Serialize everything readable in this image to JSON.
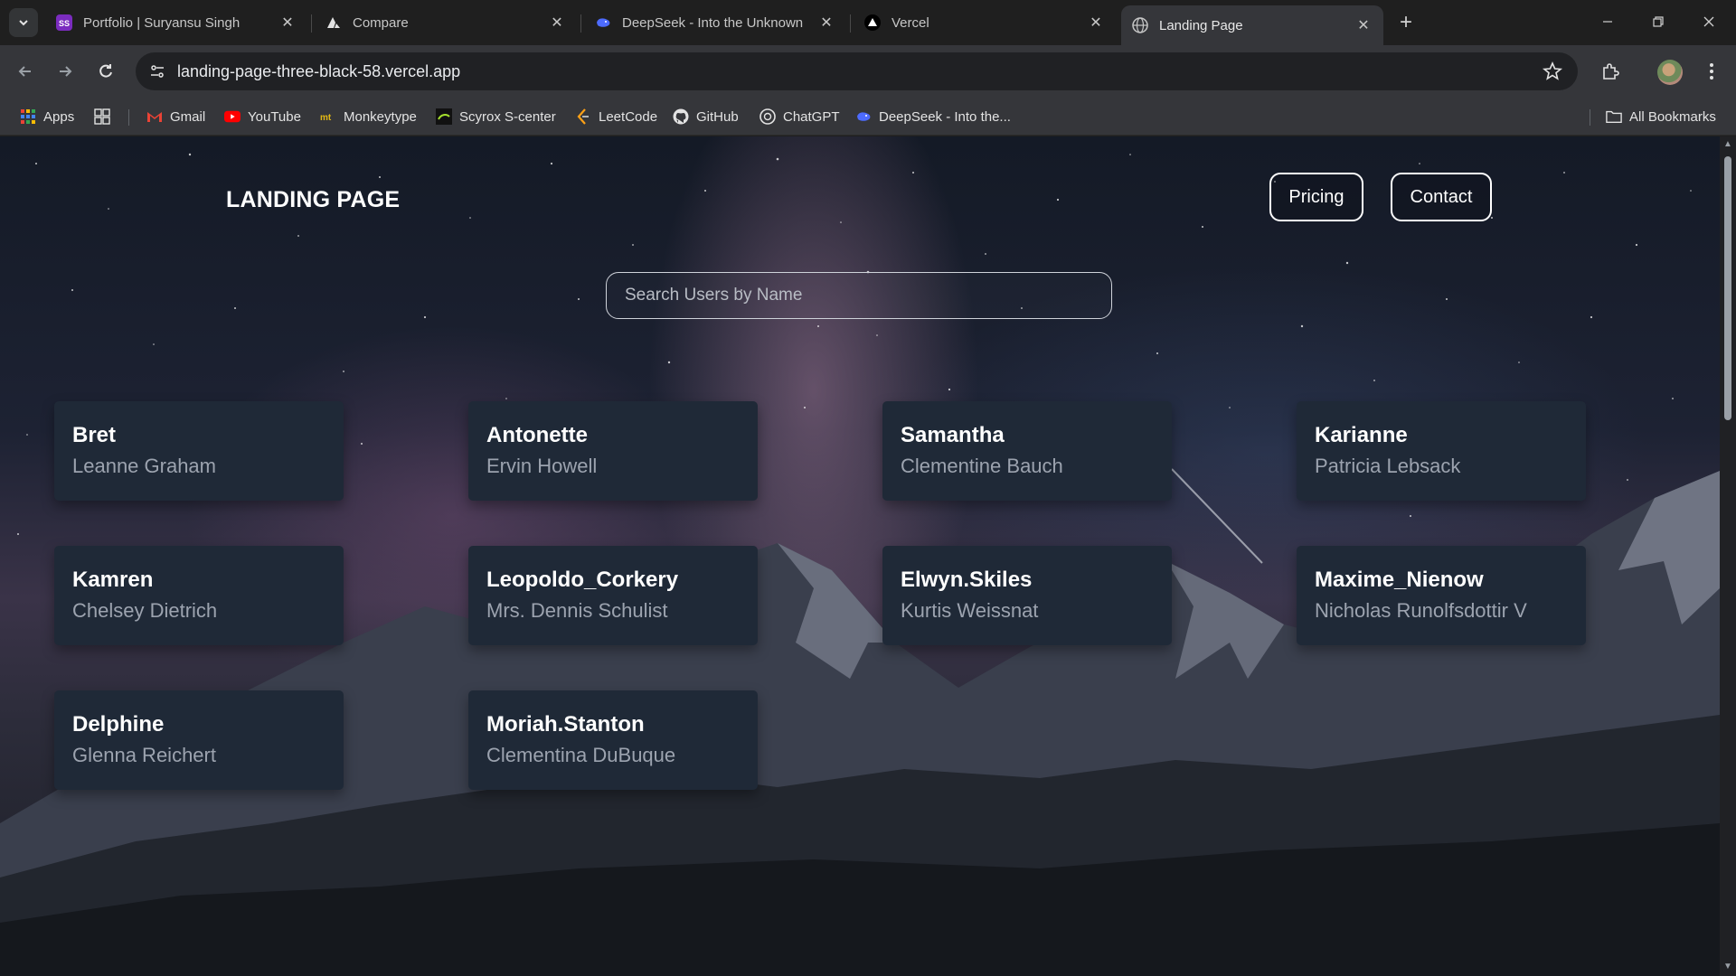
{
  "browser": {
    "tabs": [
      {
        "title": "Portfolio | Suryansu Singh",
        "favicon": "ss-logo-icon"
      },
      {
        "title": "Compare",
        "favicon": "compare-logo-icon"
      },
      {
        "title": "DeepSeek - Into the Unknown",
        "favicon": "deepseek-whale-icon"
      },
      {
        "title": "Vercel",
        "favicon": "vercel-triangle-icon"
      },
      {
        "title": "Landing Page",
        "favicon": "globe-icon",
        "active": true
      }
    ],
    "url": "landing-page-three-black-58.vercel.app",
    "bookmarks": [
      {
        "label": "Apps",
        "icon": "apps-grid-icon"
      },
      {
        "label": "",
        "icon": "tab-groups-icon"
      },
      {
        "label": "Gmail",
        "icon": "gmail-icon"
      },
      {
        "label": "YouTube",
        "icon": "youtube-icon"
      },
      {
        "label": "Monkeytype",
        "icon": "monkeytype-icon"
      },
      {
        "label": "Scyrox S-center",
        "icon": "scyrox-icon"
      },
      {
        "label": "LeetCode",
        "icon": "leetcode-icon"
      },
      {
        "label": "GitHub",
        "icon": "github-icon"
      },
      {
        "label": "ChatGPT",
        "icon": "chatgpt-icon"
      },
      {
        "label": "DeepSeek - Into the...",
        "icon": "deepseek-whale-icon"
      }
    ],
    "all_bookmarks_label": "All Bookmarks"
  },
  "page": {
    "logo": "LANDING PAGE",
    "nav": {
      "pricing": "Pricing",
      "contact": "Contact"
    },
    "search_placeholder": "Search Users by Name",
    "users": [
      {
        "username": "Bret",
        "name": "Leanne Graham"
      },
      {
        "username": "Antonette",
        "name": "Ervin Howell"
      },
      {
        "username": "Samantha",
        "name": "Clementine Bauch"
      },
      {
        "username": "Karianne",
        "name": "Patricia Lebsack"
      },
      {
        "username": "Kamren",
        "name": "Chelsey Dietrich"
      },
      {
        "username": "Leopoldo_Corkery",
        "name": "Mrs. Dennis Schulist"
      },
      {
        "username": "Elwyn.Skiles",
        "name": "Kurtis Weissnat"
      },
      {
        "username": "Maxime_Nienow",
        "name": "Nicholas Runolfsdottir V"
      },
      {
        "username": "Delphine",
        "name": "Glenna Reichert"
      },
      {
        "username": "Moriah.Stanton",
        "name": "Clementina DuBuque"
      }
    ]
  },
  "colors": {
    "card_bg": "#1f2937",
    "card_subtext": "#9ca3af",
    "chrome_bg": "#35363a",
    "tabbar_bg": "#1f1f1f"
  }
}
